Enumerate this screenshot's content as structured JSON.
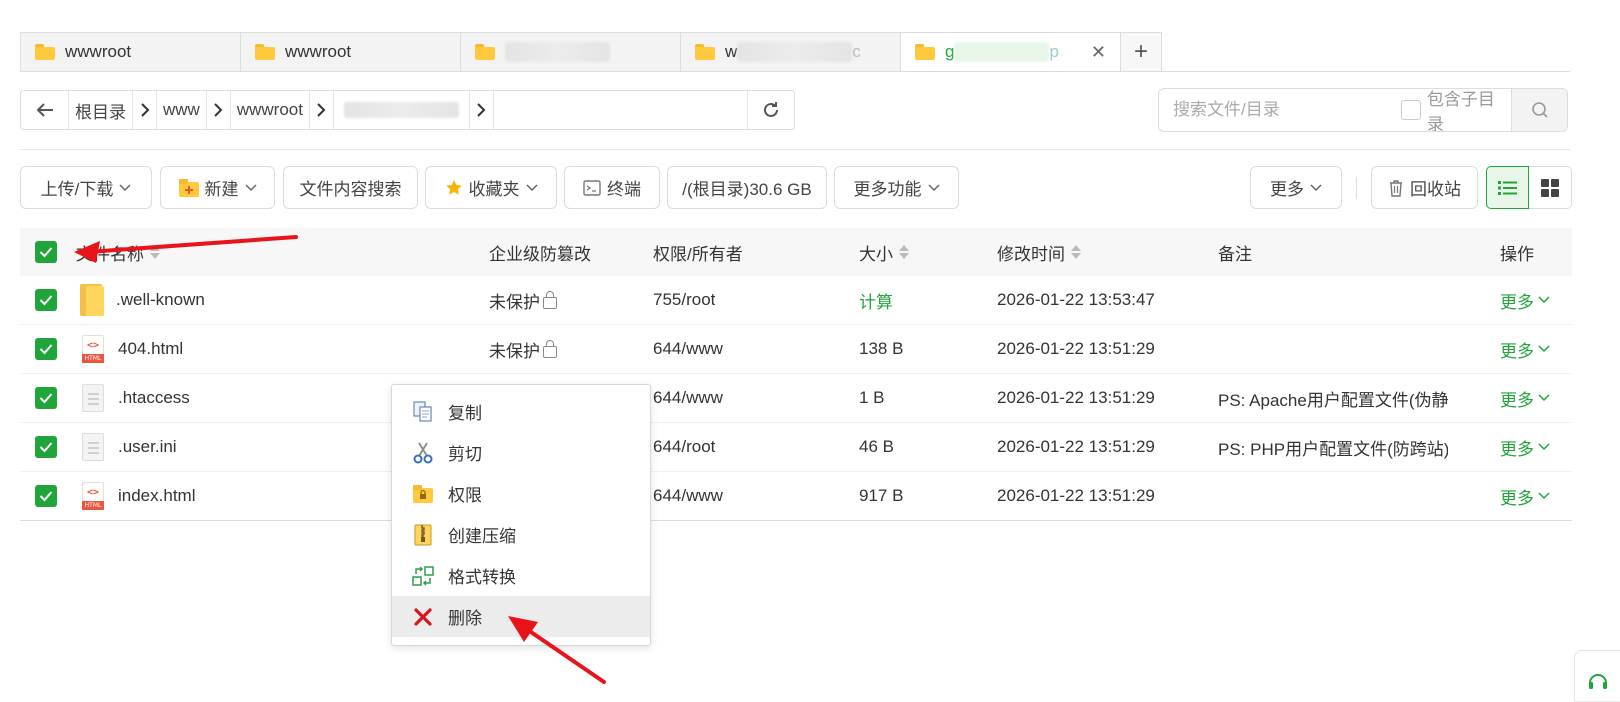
{
  "tabs": [
    {
      "label": "wwwroot",
      "active": false
    },
    {
      "label": "wwwroot",
      "active": false
    },
    {
      "label": "",
      "active": false
    },
    {
      "label": "w",
      "suffix": "c",
      "active": false
    },
    {
      "label": "g",
      "suffix": "p",
      "active": true
    }
  ],
  "tab_close": "✕",
  "tab_add": "+",
  "path": {
    "crumbs": [
      "根目录",
      "www",
      "wwwroot",
      ""
    ]
  },
  "search": {
    "placeholder": "搜索文件/目录",
    "subdir_label": "包含子目录"
  },
  "toolbar": {
    "upload": "上传/下载",
    "new": "新建",
    "content_search": "文件内容搜索",
    "favorites": "收藏夹",
    "terminal": "终端",
    "disk": "/(根目录)30.6 GB",
    "more_functions": "更多功能",
    "more": "更多",
    "recycle": "回收站"
  },
  "table": {
    "headers": {
      "name": "文件名称",
      "protect": "企业级防篡改",
      "perm": "权限/所有者",
      "size": "大小",
      "mtime": "修改时间",
      "note": "备注",
      "ops": "操作"
    },
    "rows": [
      {
        "name": ".well-known",
        "type": "folder",
        "protect": "未保护",
        "perm": "755/root",
        "size": "计算",
        "mtime": "2026-01-22 13:53:47",
        "note": "",
        "op": "更多"
      },
      {
        "name": "404.html",
        "type": "html",
        "protect": "未保护",
        "perm": "644/www",
        "size": "138 B",
        "mtime": "2026-01-22 13:51:29",
        "note": "",
        "op": "更多"
      },
      {
        "name": ".htaccess",
        "type": "file",
        "protect": "",
        "perm": "644/www",
        "size": "1 B",
        "mtime": "2026-01-22 13:51:29",
        "note": "PS: Apache用户配置文件(伪静",
        "op": "更多"
      },
      {
        "name": ".user.ini",
        "type": "file",
        "protect": "",
        "perm": "644/root",
        "size": "46 B",
        "mtime": "2026-01-22 13:51:29",
        "note": "PS: PHP用户配置文件(防跨站)",
        "op": "更多"
      },
      {
        "name": "index.html",
        "type": "html",
        "protect": "",
        "perm": "644/www",
        "size": "917 B",
        "mtime": "2026-01-22 13:51:29",
        "note": "",
        "op": "更多"
      }
    ]
  },
  "context_menu": {
    "items": [
      {
        "label": "复制",
        "icon": "copy-icon"
      },
      {
        "label": "剪切",
        "icon": "scissors-icon"
      },
      {
        "label": "权限",
        "icon": "lock-folder-icon"
      },
      {
        "label": "创建压缩",
        "icon": "zip-icon"
      },
      {
        "label": "格式转换",
        "icon": "convert-icon"
      },
      {
        "label": "删除",
        "icon": "delete-icon"
      }
    ]
  },
  "colors": {
    "accent": "#20a53a",
    "arrow": "#e8141a",
    "delete": "#d9141a"
  }
}
